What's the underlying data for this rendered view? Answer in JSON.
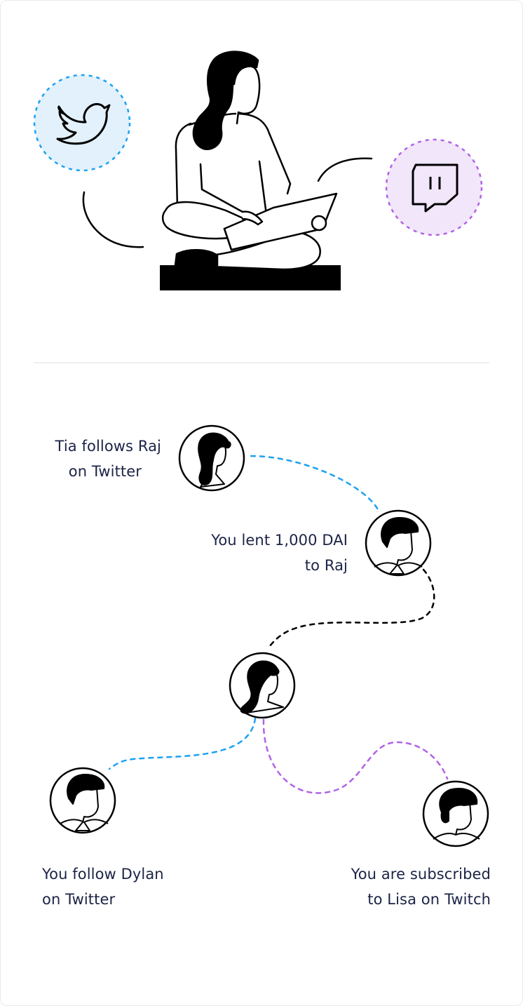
{
  "colors": {
    "ink": "#000000",
    "text": "#1c2346",
    "twitter_blue": "#1da1f2",
    "twitch_purple": "#b163e6",
    "twitter_bubble_bg": "#e2f1fb",
    "twitch_bubble_bg": "#f1e6fa"
  },
  "hero": {
    "twitter_icon": "twitter-bird-icon",
    "twitch_icon": "twitch-icon",
    "figure_icon": "woman-with-laptop-icon"
  },
  "labels": {
    "tia": {
      "line1": "Tia follows Raj",
      "line2": "on Twitter"
    },
    "raj": {
      "line1": "You lent 1,000 DAI",
      "line2": "to Raj"
    },
    "dylan": {
      "line1": "You follow Dylan",
      "line2": "on Twitter"
    },
    "lisa": {
      "line1": "You are subscribed",
      "line2": "to Lisa on Twitch"
    }
  },
  "avatars": {
    "tia": "woman-avatar-icon",
    "raj": "man-avatar-icon",
    "you": "woman-avatar-icon",
    "dylan": "man-avatar-icon",
    "lisa": "man-avatar-icon"
  }
}
